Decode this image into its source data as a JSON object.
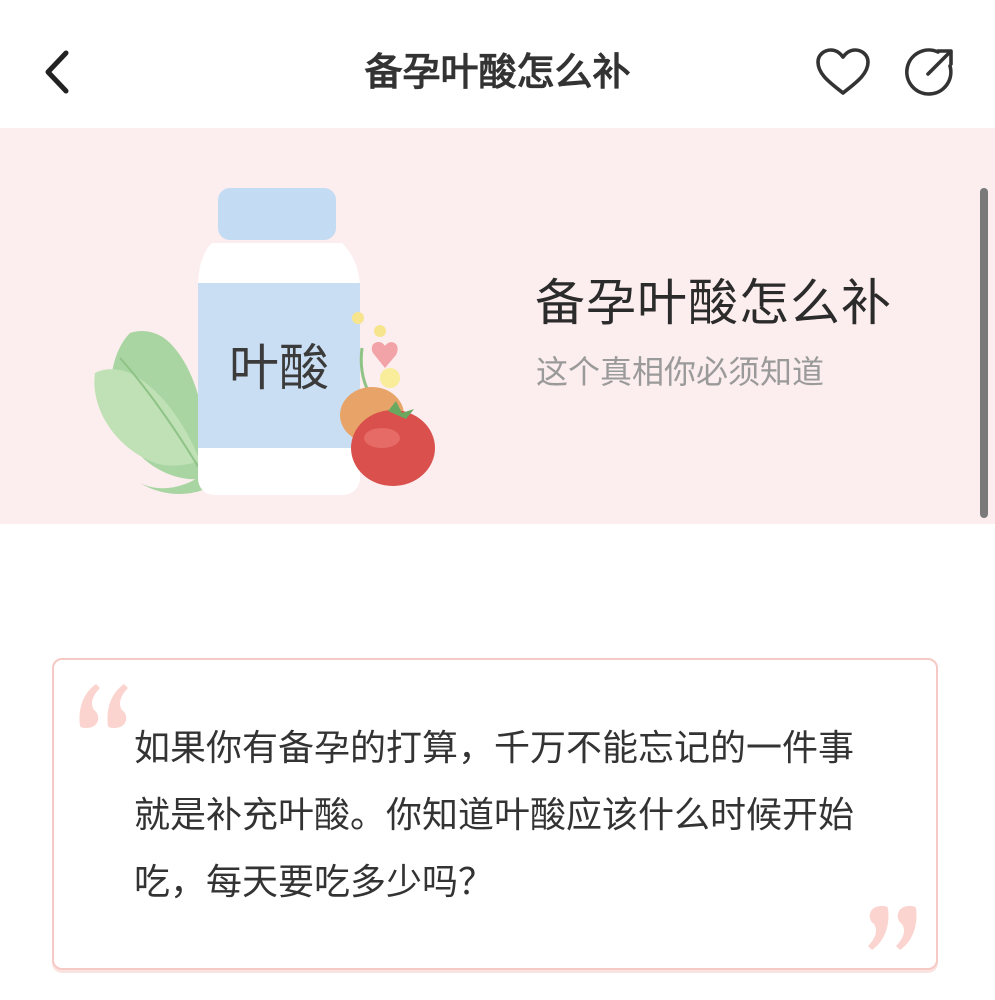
{
  "header": {
    "title": "备孕叶酸怎么补",
    "back_icon": "chevron-left-icon",
    "favorite_icon": "heart-outline-icon",
    "share_icon": "share-arrow-icon"
  },
  "banner": {
    "title": "备孕叶酸怎么补",
    "subtitle": "这个真相你必须知道",
    "bottle_label": "叶酸",
    "background_color": "#fcedee"
  },
  "quote": {
    "text": "如果你有备孕的打算，千万不能忘记的一件事就是补充叶酸。你知道叶酸应该什么时候开始吃，每天要吃多少吗？",
    "accent_color": "#f6c9c4"
  }
}
